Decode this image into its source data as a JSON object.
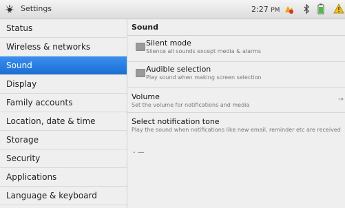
{
  "statusbar": {
    "title": "Settings",
    "time": "2:27",
    "ampm": "PM"
  },
  "sidebar": {
    "items": [
      {
        "label": "Status"
      },
      {
        "label": "Wireless & networks"
      },
      {
        "label": "Sound",
        "selected": true
      },
      {
        "label": "Display"
      },
      {
        "label": "Family accounts"
      },
      {
        "label": "Location, date & time"
      },
      {
        "label": "Storage"
      },
      {
        "label": "Security"
      },
      {
        "label": "Applications"
      },
      {
        "label": "Language & keyboard"
      }
    ]
  },
  "main": {
    "section_title": "Sound",
    "silent_mode": {
      "title": "Silent mode",
      "summary": "Silence all sounds except media & alarms",
      "checked": false
    },
    "audible_selection": {
      "title": "Audible selection",
      "summary": "Play sound when making screen selection",
      "checked": false
    },
    "volume": {
      "title": "Volume",
      "summary": "Set the volume for notifications and media"
    },
    "notification_tone": {
      "title": "Select notification tone",
      "summary": "Play the sound when notifications like new email, reminder etc are received"
    },
    "dash_text": "-  —"
  },
  "colors": {
    "selected_item": "#2a7fe6",
    "background": "#efefef"
  }
}
